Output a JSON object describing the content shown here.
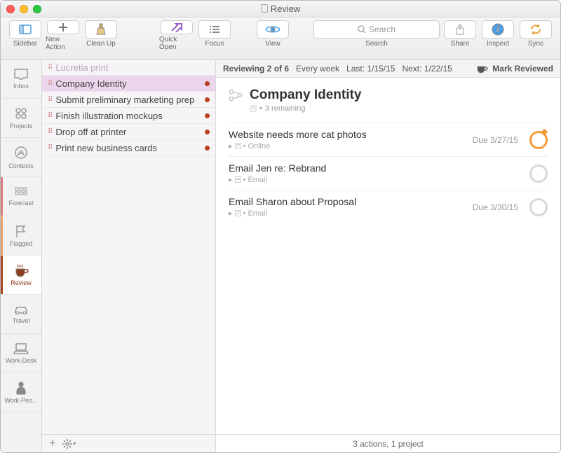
{
  "window": {
    "title": "Review"
  },
  "toolbar": {
    "sidebar": "Sidebar",
    "new_action": "New Action",
    "clean_up": "Clean Up",
    "quick_open": "Quick Open",
    "focus": "Focus",
    "view": "View",
    "search_placeholder": "Search",
    "search_label": "Search",
    "share": "Share",
    "inspect": "Inspect",
    "sync": "Sync"
  },
  "sidebar": {
    "items": [
      {
        "label": "Inbox"
      },
      {
        "label": "Projects"
      },
      {
        "label": "Contexts"
      },
      {
        "label": "Forecast"
      },
      {
        "label": "Flagged"
      },
      {
        "label": "Review"
      },
      {
        "label": "Travel"
      },
      {
        "label": "Work-Desk"
      },
      {
        "label": "Work-Peo..."
      }
    ],
    "selected_index": 5
  },
  "project_list": [
    {
      "name": "Lucretia print",
      "dim": true,
      "dot": false
    },
    {
      "name": "Company Identity",
      "dim": false,
      "dot": true,
      "selected": true
    },
    {
      "name": "Submit preliminary marketing prep",
      "dim": false,
      "dot": true
    },
    {
      "name": "Finish illustration mockups",
      "dim": false,
      "dot": true
    },
    {
      "name": "Drop off at printer",
      "dim": false,
      "dot": true
    },
    {
      "name": "Print new business cards",
      "dim": false,
      "dot": true
    }
  ],
  "review_bar": {
    "status": "Reviewing 2 of 6",
    "interval": "Every week",
    "last": "Last: 1/15/15",
    "next": "Next: 1/22/15",
    "mark_reviewed": "Mark Reviewed"
  },
  "project": {
    "title": "Company Identity",
    "subtitle": "3 remaining"
  },
  "tasks": [
    {
      "title": "Website needs more cat photos",
      "context": "Online",
      "due": "Due 3/27/15",
      "due_soon": true
    },
    {
      "title": "Email Jen re: Rebrand",
      "context": "Email",
      "due": "",
      "due_soon": false
    },
    {
      "title": "Email Sharon about Proposal",
      "context": "Email",
      "due": "Due 3/30/15",
      "due_soon": false
    }
  ],
  "status_bar": {
    "text": "3 actions, 1 project"
  }
}
